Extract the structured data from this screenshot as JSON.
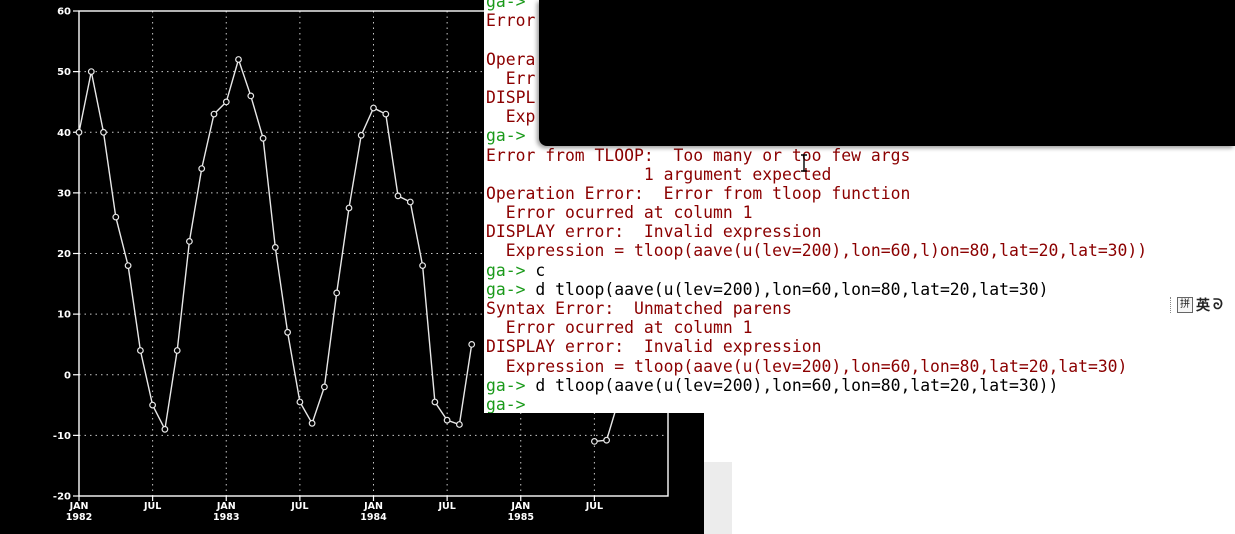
{
  "plot": {
    "chart_data": {
      "type": "line",
      "x_labels": [
        {
          "month": "JAN",
          "year": "1982"
        },
        {
          "month": "JUL",
          "year": ""
        },
        {
          "month": "JAN",
          "year": "1983"
        },
        {
          "month": "JUL",
          "year": ""
        },
        {
          "month": "JAN",
          "year": "1984"
        },
        {
          "month": "JUL",
          "year": ""
        },
        {
          "month": "JAN",
          "year": "1985"
        },
        {
          "month": "JUL",
          "year": ""
        }
      ],
      "y_ticks": [
        60,
        50,
        40,
        30,
        20,
        10,
        0,
        -10,
        -20
      ],
      "ylim": [
        -20,
        60
      ],
      "xlim": [
        0,
        52
      ],
      "grid": true,
      "series": [
        {
          "values": [
            [
              0,
              40
            ],
            [
              1,
              50
            ],
            [
              2,
              40
            ],
            [
              3,
              26
            ],
            [
              4,
              18
            ],
            [
              5,
              4
            ],
            [
              6,
              -5
            ],
            [
              7,
              -9
            ],
            [
              8,
              4
            ],
            [
              9,
              22
            ],
            [
              10,
              34
            ],
            [
              11,
              43
            ],
            [
              12,
              45
            ],
            [
              13,
              52
            ],
            [
              14,
              46
            ],
            [
              15,
              39
            ],
            [
              16,
              21
            ],
            [
              17,
              7
            ],
            [
              18,
              -4.5
            ],
            [
              19,
              -8
            ],
            [
              20,
              -2
            ],
            [
              21,
              13.5
            ],
            [
              22,
              27.5
            ],
            [
              23,
              39.5
            ],
            [
              24,
              44
            ],
            [
              25,
              43
            ],
            [
              26,
              29.5
            ],
            [
              27,
              28.5
            ],
            [
              28,
              18
            ],
            [
              29,
              -4.5
            ],
            [
              30,
              -7.5
            ],
            [
              31,
              -8.2
            ],
            [
              32,
              5
            ]
          ]
        },
        {
          "values": [
            [
              42,
              -11
            ],
            [
              43,
              -10.8
            ],
            [
              44,
              -4
            ]
          ]
        }
      ]
    },
    "colors": {
      "line": "#e8e8e8",
      "grid": "#c8c8c8",
      "text": "#ffffff",
      "background": "#000000"
    }
  },
  "terminal": {
    "colors": {
      "prompt": "#1a9a1a",
      "error": "#8b0000",
      "command": "#000000"
    },
    "lines": [
      {
        "type": "prompt",
        "prompt": "ga->",
        "text": ""
      },
      {
        "type": "error",
        "text": "Error"
      },
      {
        "type": "blank",
        "text": ""
      },
      {
        "type": "error",
        "text": "Opera"
      },
      {
        "type": "error",
        "text": "  Err"
      },
      {
        "type": "error",
        "text": "DISPL"
      },
      {
        "type": "error",
        "text": "  Exp"
      },
      {
        "type": "prompt",
        "prompt": "ga->",
        "text": ""
      },
      {
        "type": "error",
        "text": "Error from TLOOP:  Too many or too few args"
      },
      {
        "type": "error",
        "text": "                1 argument expected"
      },
      {
        "type": "error",
        "text": "Operation Error:  Error from tloop function"
      },
      {
        "type": "error",
        "text": "  Error ocurred at column 1"
      },
      {
        "type": "error",
        "text": "DISPLAY error:  Invalid expression"
      },
      {
        "type": "error",
        "text": "  Expression = tloop(aave(u(lev=200),lon=60,l)on=80,lat=20,lat=30))"
      },
      {
        "type": "prompt",
        "prompt": "ga->",
        "text": " c"
      },
      {
        "type": "prompt",
        "prompt": "ga->",
        "text": " d tloop(aave(u(lev=200),lon=60,lon=80,lat=20,lat=30)"
      },
      {
        "type": "error",
        "text": "Syntax Error:  Unmatched parens"
      },
      {
        "type": "error",
        "text": "  Error ocurred at column 1"
      },
      {
        "type": "error",
        "text": "DISPLAY error:  Invalid expression"
      },
      {
        "type": "error",
        "text": "  Expression = tloop(aave(u(lev=200),lon=60,lon=80,lat=20,lat=30)"
      },
      {
        "type": "prompt",
        "prompt": "ga->",
        "text": " d tloop(aave(u(lev=200),lon=60,lon=80,lat=20,lat=30))"
      },
      {
        "type": "prompt",
        "prompt": "ga->",
        "text": ""
      }
    ]
  },
  "ime": {
    "icon": "grid-icon",
    "icon_glyph": "拼",
    "mode_label": "英",
    "extra_glyph": "ᘐ"
  }
}
